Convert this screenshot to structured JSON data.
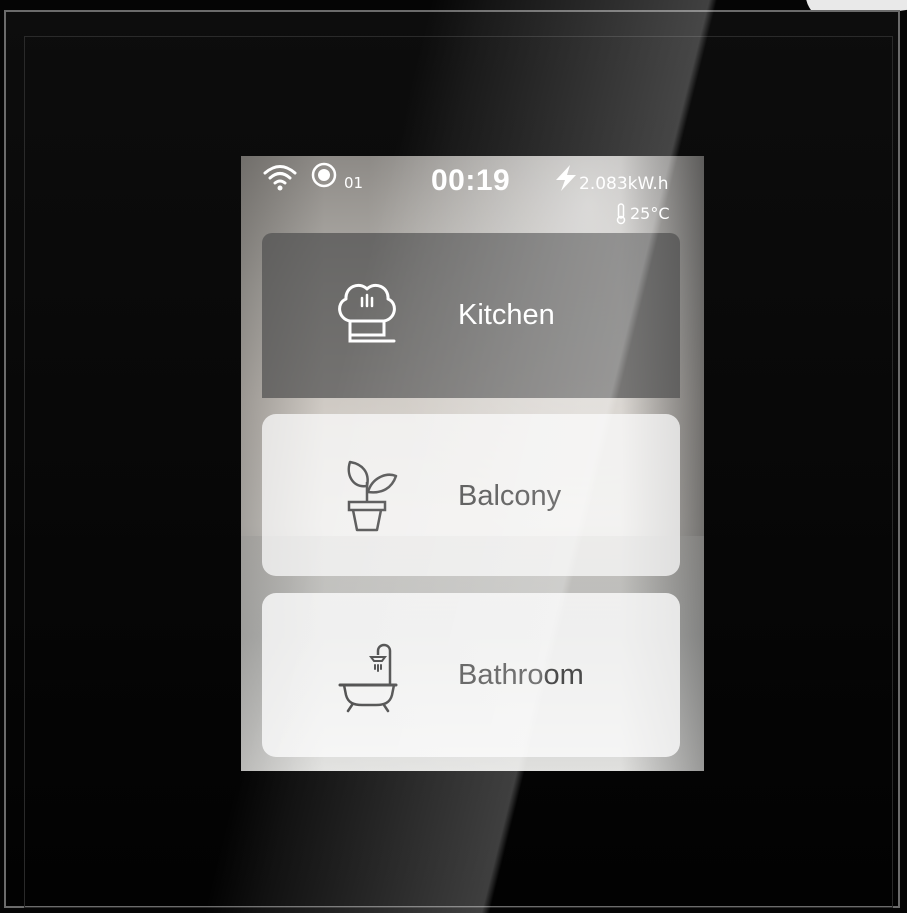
{
  "status": {
    "wifi_icon": "wifi-icon",
    "record_icon": "record-icon",
    "channel": "01",
    "time": "00:19",
    "energy_icon": "lightning-icon",
    "energy": "2.083kW.h",
    "temperature_icon": "thermometer-icon",
    "temperature": "25°C"
  },
  "rooms": [
    {
      "label": "Kitchen",
      "icon": "chef-hat-icon",
      "selected": true
    },
    {
      "label": "Balcony",
      "icon": "potted-plant-icon",
      "selected": false
    },
    {
      "label": "Bathroom",
      "icon": "bathtub-icon",
      "selected": false
    }
  ],
  "colors": {
    "frame": "#050505",
    "active_tile": "#505050",
    "idle_tile": "#fafafa",
    "active_text": "#ffffff",
    "idle_text": "#4a4a4a"
  }
}
